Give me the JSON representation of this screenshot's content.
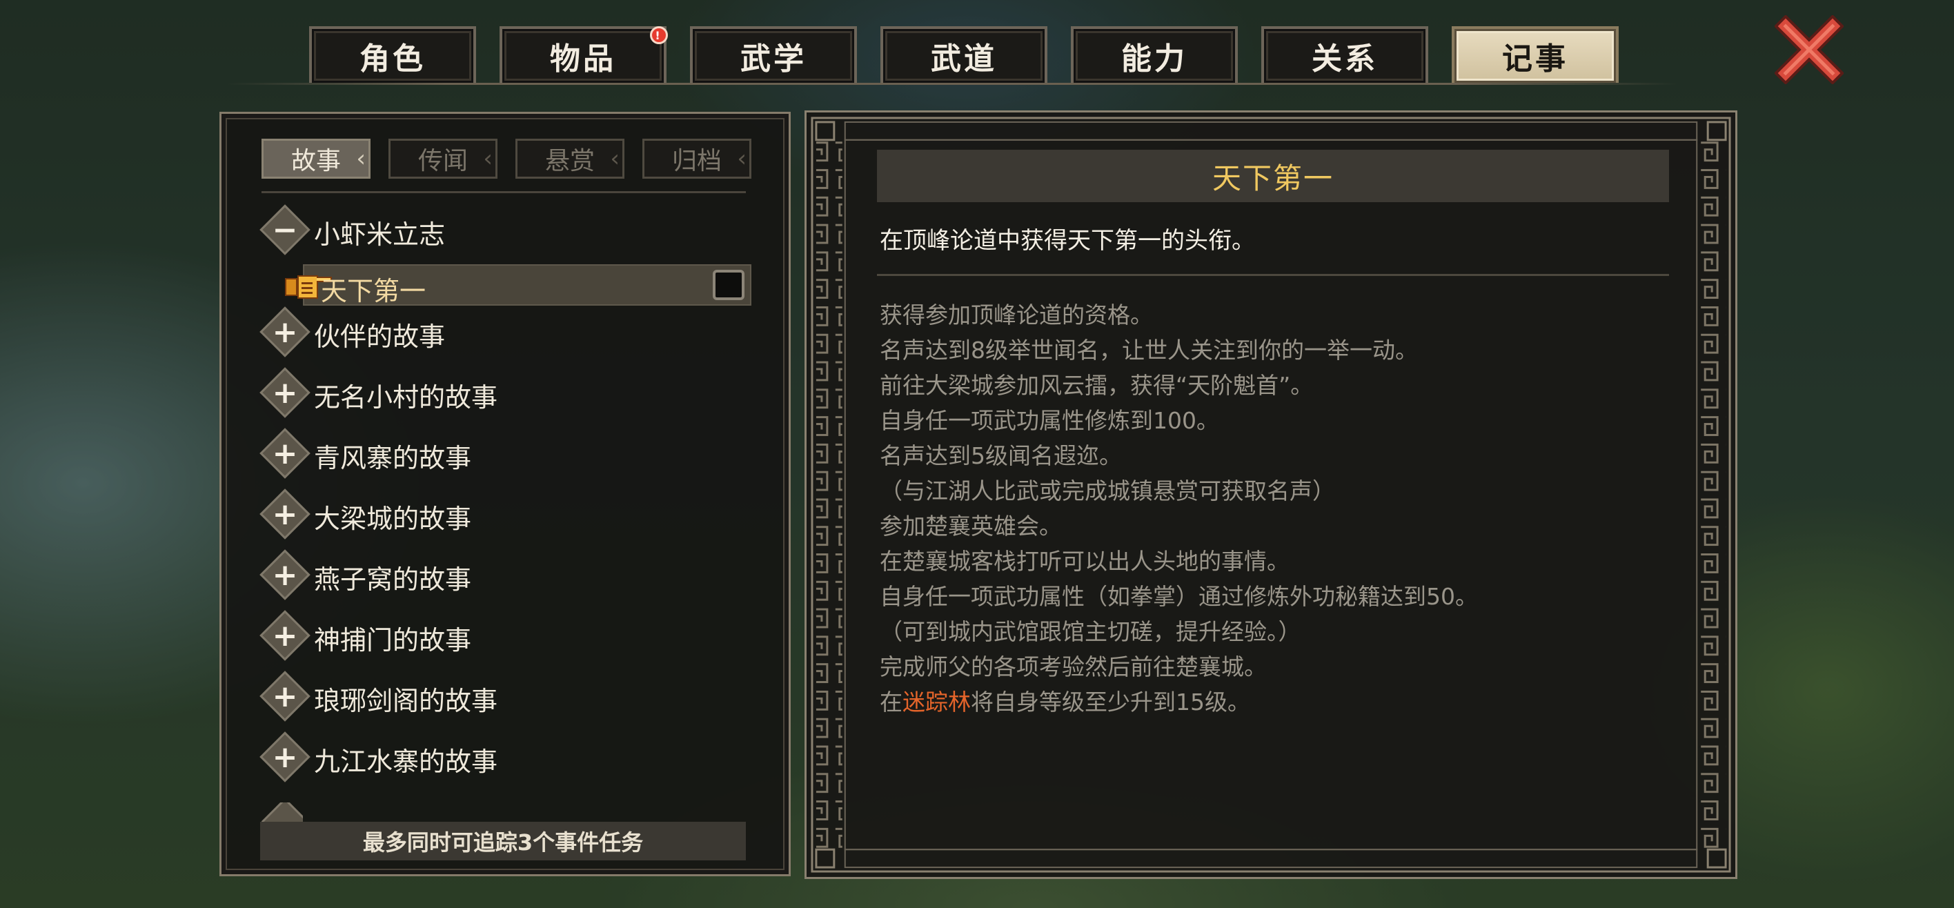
{
  "tabs": [
    {
      "label": "角色",
      "active": false,
      "badge": ""
    },
    {
      "label": "物品",
      "active": false,
      "badge": "!"
    },
    {
      "label": "武学",
      "active": false,
      "badge": ""
    },
    {
      "label": "武道",
      "active": false,
      "badge": ""
    },
    {
      "label": "能力",
      "active": false,
      "badge": ""
    },
    {
      "label": "关系",
      "active": false,
      "badge": ""
    },
    {
      "label": "记事",
      "active": true,
      "badge": ""
    }
  ],
  "subtabs": [
    {
      "label": "故事",
      "active": true
    },
    {
      "label": "传闻",
      "active": false
    },
    {
      "label": "悬赏",
      "active": false
    },
    {
      "label": "归档",
      "active": false
    }
  ],
  "tree": {
    "expanded": {
      "label": "小虾米立志",
      "sign": "−"
    },
    "selected": {
      "label": "天下第一"
    },
    "groups": [
      {
        "label": "伙伴的故事",
        "sign": "+"
      },
      {
        "label": "无名小村的故事",
        "sign": "+"
      },
      {
        "label": "青风寨的故事",
        "sign": "+"
      },
      {
        "label": "大梁城的故事",
        "sign": "+"
      },
      {
        "label": "燕子窝的故事",
        "sign": "+"
      },
      {
        "label": "神捕门的故事",
        "sign": "+"
      },
      {
        "label": "琅琊剑阁的故事",
        "sign": "+"
      },
      {
        "label": "九江水寨的故事",
        "sign": "+"
      }
    ]
  },
  "footer": "最多同时可追踪3个事件任务",
  "detail": {
    "title": "天下第一",
    "description": "在顶峰论道中获得天下第一的头衔。",
    "conditions": [
      "获得参加顶峰论道的资格。",
      "名声达到8级举世闻名，让世人关注到你的一举一动。",
      "前往大梁城参加风云擂，获得“天阶魁首”。",
      "自身任一项武功属性修炼到100。",
      "名声达到5级闻名遐迩。",
      "（与江湖人比武或完成城镇悬赏可获取名声）",
      "参加楚襄英雄会。",
      "在楚襄城客栈打听可以出人头地的事情。",
      "自身任一项武功属性（如拳掌）通过修炼外功秘籍达到50。",
      "（可到城内武馆跟馆主切磋，提升经验。）",
      "完成师父的各项考验然后前往楚襄城。"
    ],
    "last_condition": {
      "prefix": "在",
      "highlight": "迷踪林",
      "suffix": "将自身等级至少升到15级。"
    }
  },
  "colors": {
    "title_gold": "#f0c860",
    "highlight_orange": "#e4642a",
    "close_red": "#d84a3c"
  },
  "icons": {
    "close": "close-x-icon",
    "pointer": "pointing-hand-icon"
  }
}
